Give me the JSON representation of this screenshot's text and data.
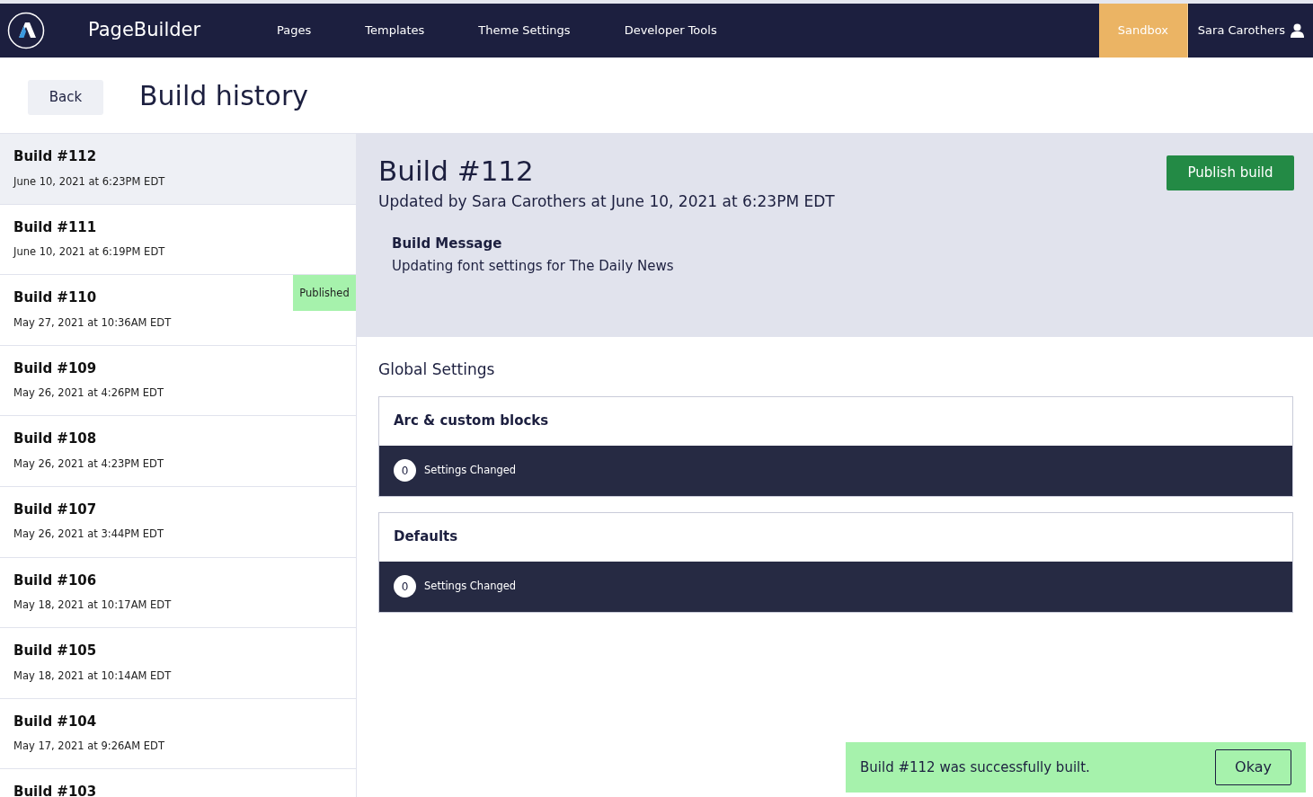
{
  "header": {
    "app_name": "PageBuilder",
    "nav": [
      {
        "label": "Pages"
      },
      {
        "label": "Templates"
      },
      {
        "label": "Theme Settings"
      },
      {
        "label": "Developer Tools"
      }
    ],
    "environment": "Sandbox",
    "user": "Sara Carothers"
  },
  "page": {
    "back": "Back",
    "title": "Build history"
  },
  "builds": [
    {
      "name": "Build #112",
      "date": "June 10, 2021 at 6:23PM EDT",
      "selected": true
    },
    {
      "name": "Build #111",
      "date": "June 10, 2021 at 6:19PM EDT",
      "selected": false
    },
    {
      "name": "Build #110",
      "date": "May 27, 2021 at 10:36AM EDT",
      "selected": false,
      "badge": "Published"
    },
    {
      "name": "Build #109",
      "date": "May 26, 2021 at 4:26PM EDT",
      "selected": false
    },
    {
      "name": "Build #108",
      "date": "May 26, 2021 at 4:23PM EDT",
      "selected": false
    },
    {
      "name": "Build #107",
      "date": "May 26, 2021 at 3:44PM EDT",
      "selected": false
    },
    {
      "name": "Build #106",
      "date": "May 18, 2021 at 10:17AM EDT",
      "selected": false
    },
    {
      "name": "Build #105",
      "date": "May 18, 2021 at 10:14AM EDT",
      "selected": false
    },
    {
      "name": "Build #104",
      "date": "May 17, 2021 at 9:26AM EDT",
      "selected": false
    },
    {
      "name": "Build #103",
      "selected": false
    }
  ],
  "detail": {
    "title": "Build #112",
    "updated": "Updated by Sara Carothers at June 10, 2021 at 6:23PM EDT",
    "publish": "Publish build",
    "message_label": "Build Message",
    "message": "Updating font settings for The Daily News",
    "section": "Global Settings",
    "groups": [
      {
        "name": "Arc & custom blocks",
        "count": "0",
        "label": "Settings Changed"
      },
      {
        "name": "Defaults",
        "count": "0",
        "label": "Settings Changed"
      }
    ]
  },
  "toast": {
    "message": "Build #112 was successfully built.",
    "button": "Okay"
  }
}
